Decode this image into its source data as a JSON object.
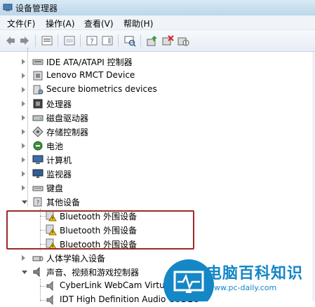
{
  "window": {
    "title": "设备管理器"
  },
  "menu": [
    "文件(F)",
    "操作(A)",
    "查看(V)",
    "帮助(H)"
  ],
  "tree": {
    "items": [
      {
        "label": "IDE ATA/ATAPI 控制器",
        "icon": "ide-controller-icon",
        "state": "closed"
      },
      {
        "label": "Lenovo RMCT Device",
        "icon": "device-icon",
        "state": "closed"
      },
      {
        "label": "Secure biometrics devices",
        "icon": "biometric-icon",
        "state": "closed"
      },
      {
        "label": "处理器",
        "icon": "processor-icon",
        "state": "closed"
      },
      {
        "label": "磁盘驱动器",
        "icon": "disk-drive-icon",
        "state": "closed"
      },
      {
        "label": "存储控制器",
        "icon": "storage-controller-icon",
        "state": "closed"
      },
      {
        "label": "电池",
        "icon": "battery-icon",
        "state": "closed"
      },
      {
        "label": "计算机",
        "icon": "computer-icon",
        "state": "closed"
      },
      {
        "label": "监视器",
        "icon": "monitor-icon",
        "state": "closed"
      },
      {
        "label": "键盘",
        "icon": "keyboard-icon",
        "state": "closed"
      },
      {
        "label": "其他设备",
        "icon": "other-devices-icon",
        "state": "open"
      }
    ],
    "other_children": [
      "Bluetooth 外围设备",
      "Bluetooth 外围设备",
      "Bluetooth 外围设备"
    ],
    "after_items": [
      {
        "label": "人体学输入设备",
        "icon": "hid-icon",
        "state": "closed"
      },
      {
        "label": "声音、视频和游戏控制器",
        "icon": "sound-icon",
        "state": "open"
      }
    ],
    "sound_children": [
      "CyberLink WebCam Virtual",
      "IDT High Definition Audio CODEC"
    ]
  },
  "watermark": {
    "name": "电脑百科知识",
    "url": "www.pc-daily.com"
  },
  "colors": {
    "highlight": "#9b2a2a",
    "warning": "#f2c200",
    "watermark": "#1487c7"
  }
}
